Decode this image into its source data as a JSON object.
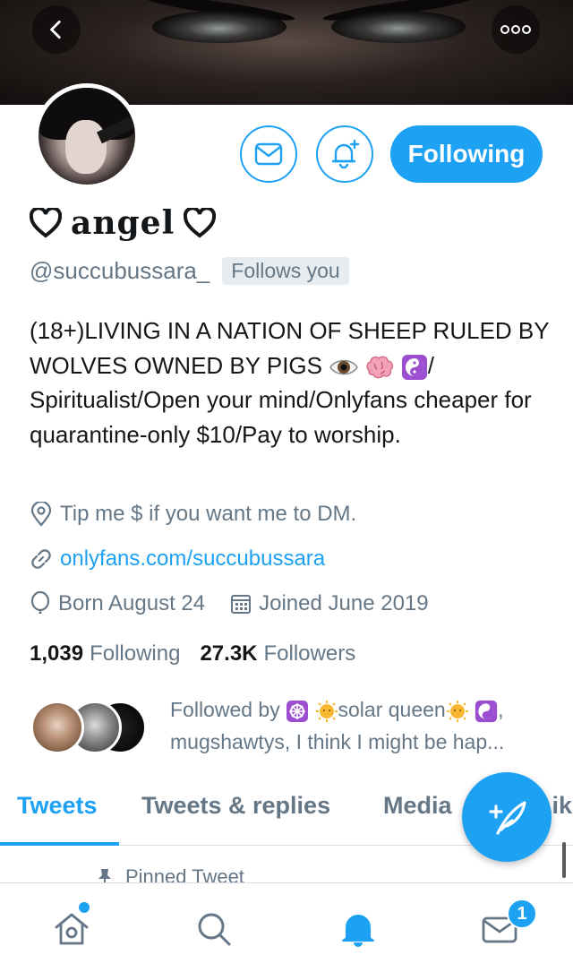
{
  "profile": {
    "display_name": "angel",
    "handle": "@succubussara_",
    "follows_you_label": "Follows you",
    "bio": "(18+)LIVING IN A NATION OF SHEEP RULED BY WOLVES OWNED BY PIGS",
    "bio_emojis": [
      "eye",
      "brain",
      "yin-yang"
    ],
    "bio_rest": "/ Spiritualist/Open your mind/Onlyfans cheaper for quarantine-only $10/Pay to worship.",
    "location": "Tip me $ if you want me to DM.",
    "website": "onlyfans.com/succubussara",
    "birthday": "Born August 24",
    "joined": "Joined June 2019"
  },
  "actions": {
    "following_label": "Following",
    "message_icon": "mail-icon",
    "notify_icon": "bell-plus-icon"
  },
  "stats": {
    "following_count": "1,039",
    "following_label": "Following",
    "followers_count": "27.3K",
    "followers_label": "Followers"
  },
  "followed_by": {
    "prefix": "Followed by",
    "first_name": "solar queen",
    "rest": ", mugshawtys, I think I might be hap..."
  },
  "tabs": [
    {
      "label": "Tweets",
      "active": true
    },
    {
      "label": "Tweets & replies",
      "active": false
    },
    {
      "label": "Media",
      "active": false
    },
    {
      "label": "Likes",
      "active": false
    }
  ],
  "pinned_label": "Pinned Tweet",
  "nav": {
    "items": [
      "home-icon",
      "search-icon",
      "bell-icon",
      "mail-icon"
    ],
    "messages_badge": "1"
  },
  "colors": {
    "accent": "#1da1f2",
    "muted": "#657786",
    "text": "#14171a"
  }
}
